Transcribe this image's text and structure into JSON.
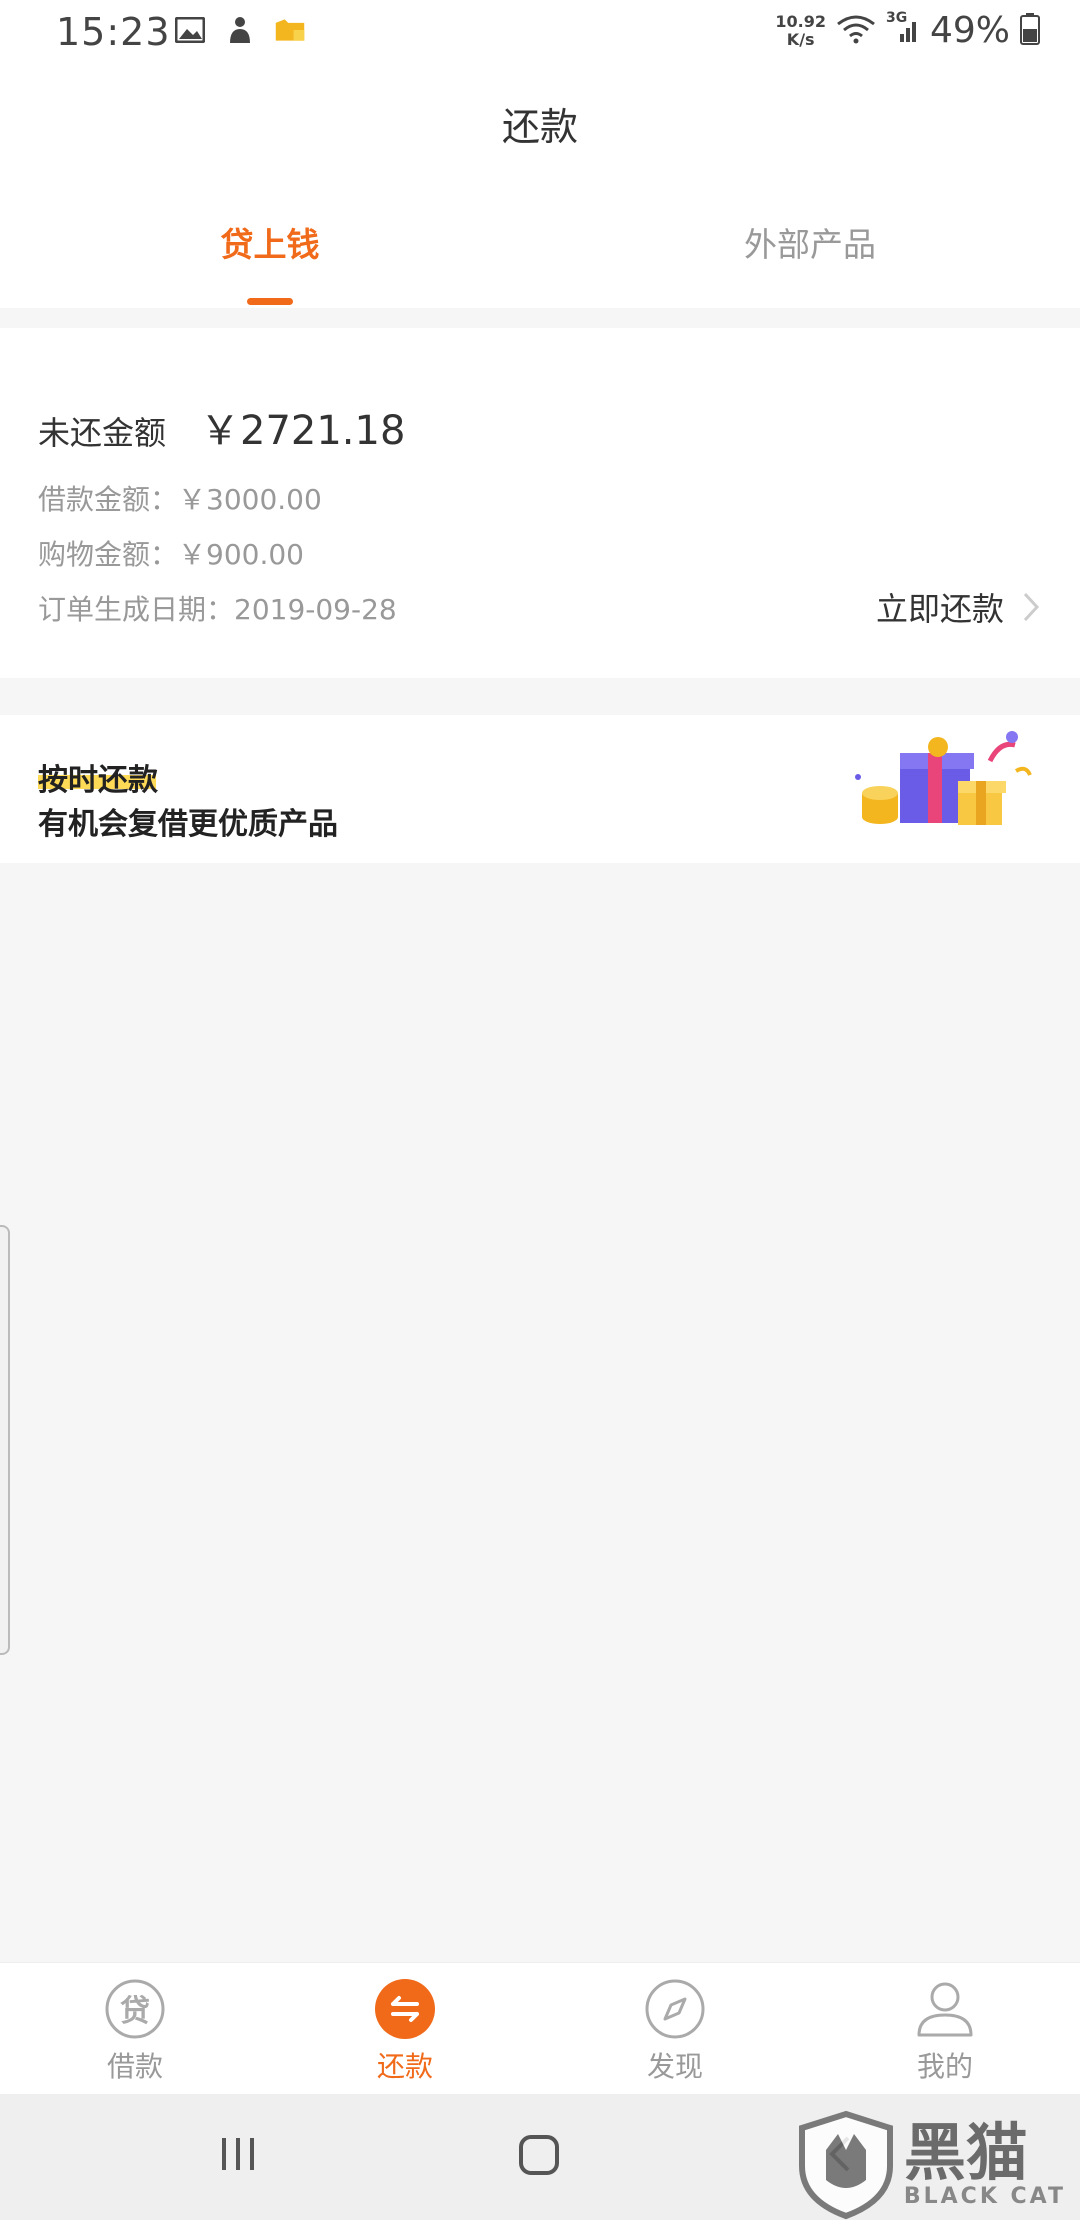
{
  "status_bar": {
    "time": "15:23",
    "net_speed_value": "10.92",
    "net_speed_unit": "K/s",
    "network_type": "3G",
    "battery": "49%",
    "icons": [
      "gallery-icon",
      "person-icon",
      "folder-icon",
      "wifi-icon",
      "signal-icon",
      "battery-icon"
    ]
  },
  "header": {
    "title": "还款"
  },
  "tabs": [
    {
      "label": "贷上钱",
      "active": true
    },
    {
      "label": "外部产品",
      "active": false
    }
  ],
  "summary": {
    "outstanding_label": "未还金额",
    "outstanding_amount": "￥2721.18",
    "loan_amount": "借款金额：￥3000.00",
    "shopping_amount": "购物金额：￥900.00",
    "order_date": "订单生成日期：2019-09-28",
    "repay_now_label": "立即还款"
  },
  "banner": {
    "line1": "按时还款",
    "line2": "有机会复借更优质产品"
  },
  "bottom_nav": [
    {
      "label": "借款",
      "icon": "loan-icon",
      "active": false,
      "icon_glyph": "贷"
    },
    {
      "label": "还款",
      "icon": "repay-icon",
      "active": true
    },
    {
      "label": "发现",
      "icon": "compass-icon",
      "active": false
    },
    {
      "label": "我的",
      "icon": "profile-icon",
      "active": false
    }
  ],
  "watermark": {
    "cn": "黑猫",
    "en": "BLACK CAT"
  },
  "colors": {
    "accent": "#f06a1a",
    "highlight": "#ffd43a",
    "background": "#f6f6f6"
  }
}
